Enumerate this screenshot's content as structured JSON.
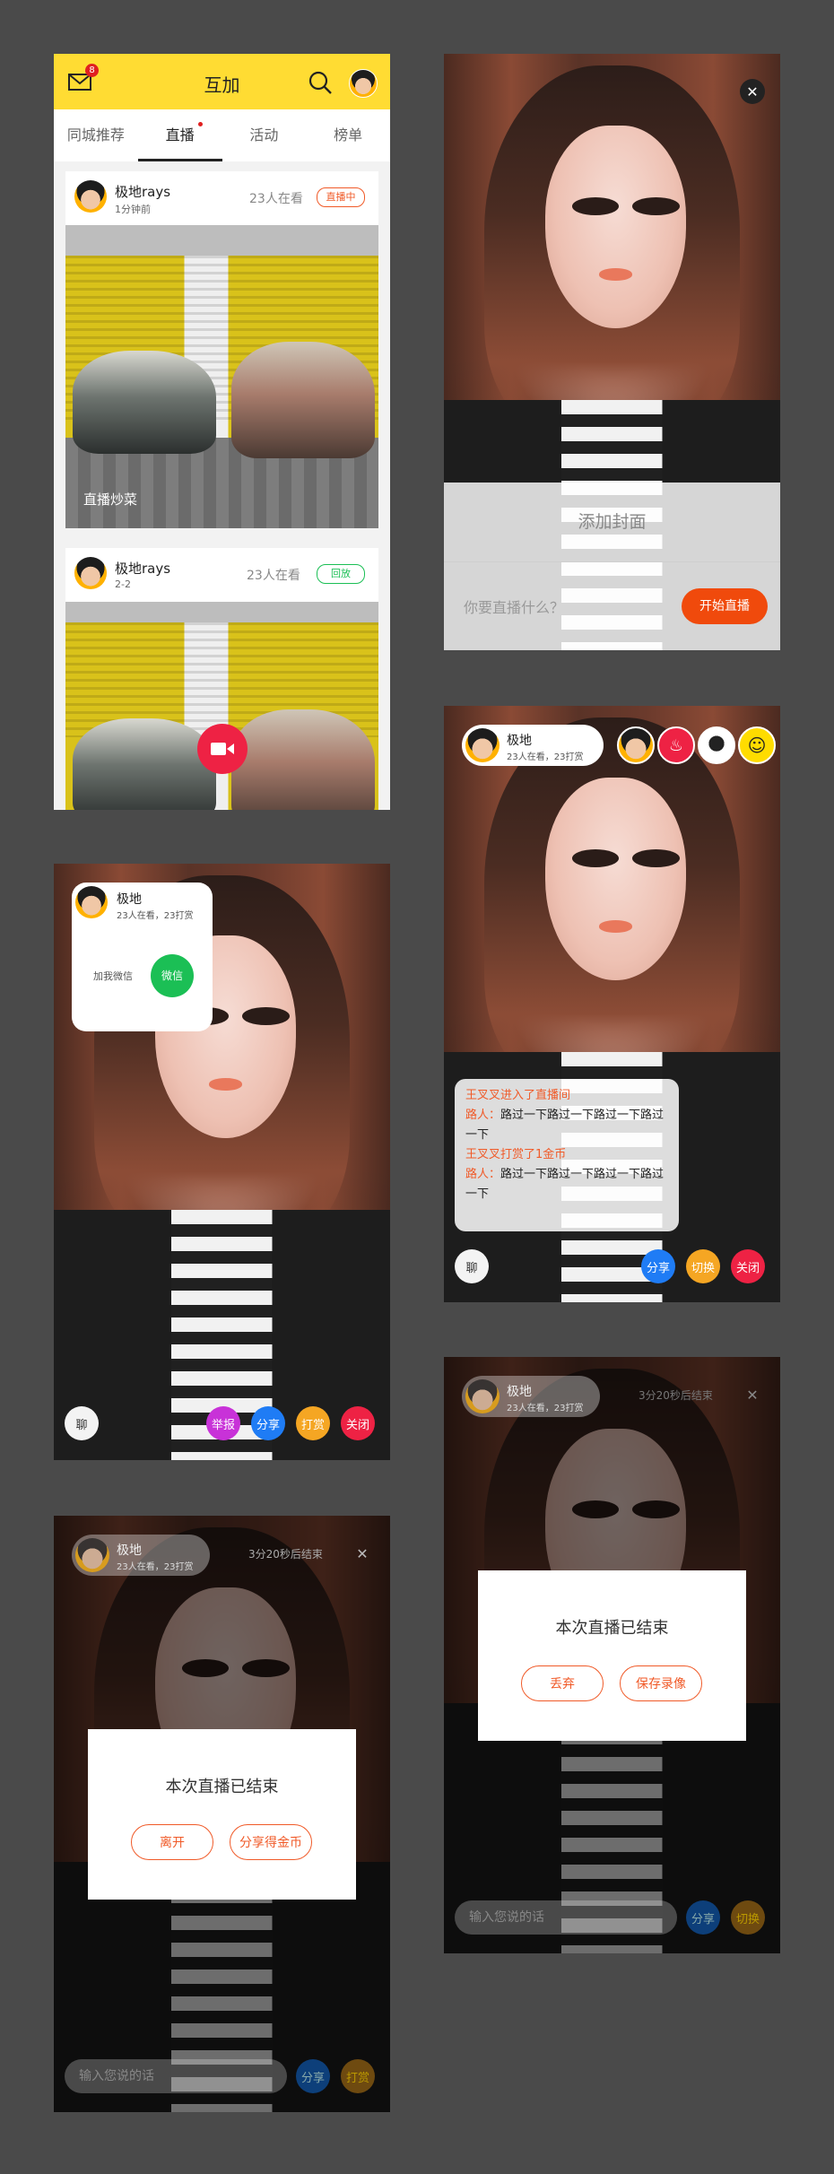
{
  "feed": {
    "mail_badge": "8",
    "title": "互加",
    "tabs": [
      "同城推荐",
      "直播",
      "活动",
      "榜单"
    ],
    "active_tab": "直播",
    "cards": [
      {
        "name": "极地rays",
        "time": "1分钟前",
        "viewers": "23人在看",
        "status": "直播中",
        "caption": "直播炒菜"
      },
      {
        "name": "极地rays",
        "time": "2-2",
        "viewers": "23人在看",
        "status": "回放"
      }
    ]
  },
  "setup": {
    "cover_label": "添加封面",
    "input_placeholder": "你要直播什么？",
    "start_button": "开始直播"
  },
  "viewer": {
    "host_name": "极地",
    "host_stats": "23人在看，23打赏",
    "wechat_label": "加我微信",
    "wechat_button": "微信",
    "chat_button": "聊",
    "actions": [
      "举报",
      "分享",
      "打赏",
      "关闭"
    ]
  },
  "host_live": {
    "host_name": "极地",
    "host_stats": "23人在看，23打赏",
    "messages": [
      {
        "type": "system",
        "text": "王叉叉进入了直播间"
      },
      {
        "type": "chat",
        "name": "路人：",
        "text": "路过一下路过一下路过一下路过一下"
      },
      {
        "type": "system",
        "text": "王叉叉打赏了1金币"
      },
      {
        "type": "chat",
        "name": "路人：",
        "text": "路过一下路过一下路过一下路过一下"
      }
    ],
    "chat_button": "聊",
    "actions": [
      "分享",
      "切换",
      "关闭"
    ]
  },
  "ended_viewer": {
    "host_name": "极地",
    "host_stats": "23人在看，23打赏",
    "countdown": "3分20秒后结束",
    "dialog_title": "本次直播已结束",
    "buttons": [
      "离开",
      "分享得金币"
    ],
    "input_placeholder": "输入您说的话",
    "actions": [
      "分享",
      "打赏"
    ]
  },
  "ended_host": {
    "host_name": "极地",
    "host_stats": "23人在看，23打赏",
    "countdown": "3分20秒后结束",
    "dialog_title": "本次直播已结束",
    "buttons": [
      "丢弃",
      "保存录像"
    ],
    "input_placeholder": "输入您说的话",
    "actions": [
      "分享",
      "切换"
    ]
  },
  "colors": {
    "yellow": "#ffdc33",
    "orange": "#f05a28",
    "green": "#1bbf55",
    "blue": "#1f7cf5",
    "amber": "#f5a623",
    "red": "#ee2244",
    "purple": "#c832d8"
  }
}
